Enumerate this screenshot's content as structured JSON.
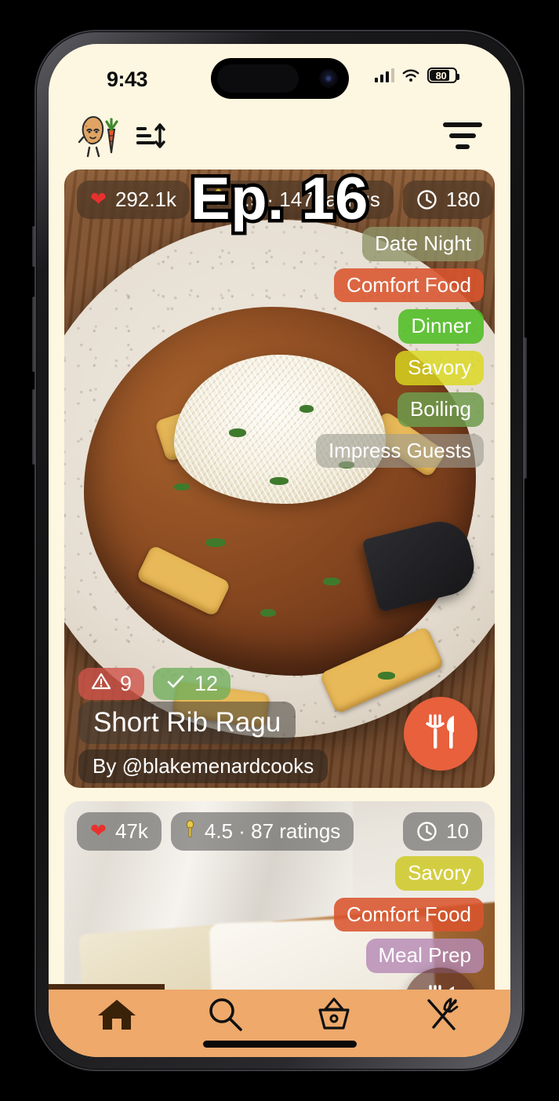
{
  "status_bar": {
    "time": "9:43",
    "battery_percent": "80",
    "signal_icon": "cellular-signal-icon",
    "wifi_icon": "wifi-icon",
    "battery_icon": "battery-icon"
  },
  "header": {
    "logo_icon": "potato-carrot-logo",
    "sort_icon": "sort-icon",
    "filter_icon": "filter-icon"
  },
  "feed": {
    "cards": [
      {
        "likes": "292.1k",
        "rating": "4.9 · 147 ratings",
        "duration": "180",
        "episode": "Ep. 16",
        "warnings": "9",
        "checks": "12",
        "title": "Short Rib Ragu",
        "author": "By @blakemenardcooks",
        "heart_icon": "heart-icon",
        "spoon_icon": "spoon-icon",
        "clock_icon": "clock-icon",
        "warning_icon": "warning-triangle-icon",
        "check_icon": "check-icon",
        "fab_icon": "fork-knife-icon",
        "tags": [
          {
            "label": "Date Night",
            "color": "#8e9468"
          },
          {
            "label": "Comfort Food",
            "color": "#d9542e"
          },
          {
            "label": "Dinner",
            "color": "#4fbd23"
          },
          {
            "label": "Savory",
            "color": "#dbd81f"
          },
          {
            "label": "Boiling",
            "color": "#6d9b4b"
          },
          {
            "label": "Impress Guests",
            "color": "#9e9e93"
          }
        ]
      },
      {
        "likes": "47k",
        "rating": "4.5 · 87 ratings",
        "duration": "10",
        "heart_icon": "heart-icon",
        "spoon_icon": "spoon-icon",
        "clock_icon": "clock-icon",
        "fab_icon": "fork-knife-icon",
        "tags": [
          {
            "label": "Savory",
            "color": "#cfc92a"
          },
          {
            "label": "Comfort Food",
            "color": "#d9542e"
          },
          {
            "label": "Meal Prep",
            "color": "#b68ab4"
          }
        ]
      }
    ]
  },
  "bottom_nav": {
    "items": [
      {
        "name": "home",
        "icon": "home-icon",
        "active": true
      },
      {
        "name": "search",
        "icon": "search-icon",
        "active": false
      },
      {
        "name": "basket",
        "icon": "basket-icon",
        "active": false
      },
      {
        "name": "recipes",
        "icon": "fork-knife-crossed-icon",
        "active": false
      }
    ]
  },
  "colors": {
    "background": "#fdf6e0",
    "nav_background": "#eea96b",
    "accent": "#e8603c",
    "scroll_indicator": "#4a2a10"
  }
}
